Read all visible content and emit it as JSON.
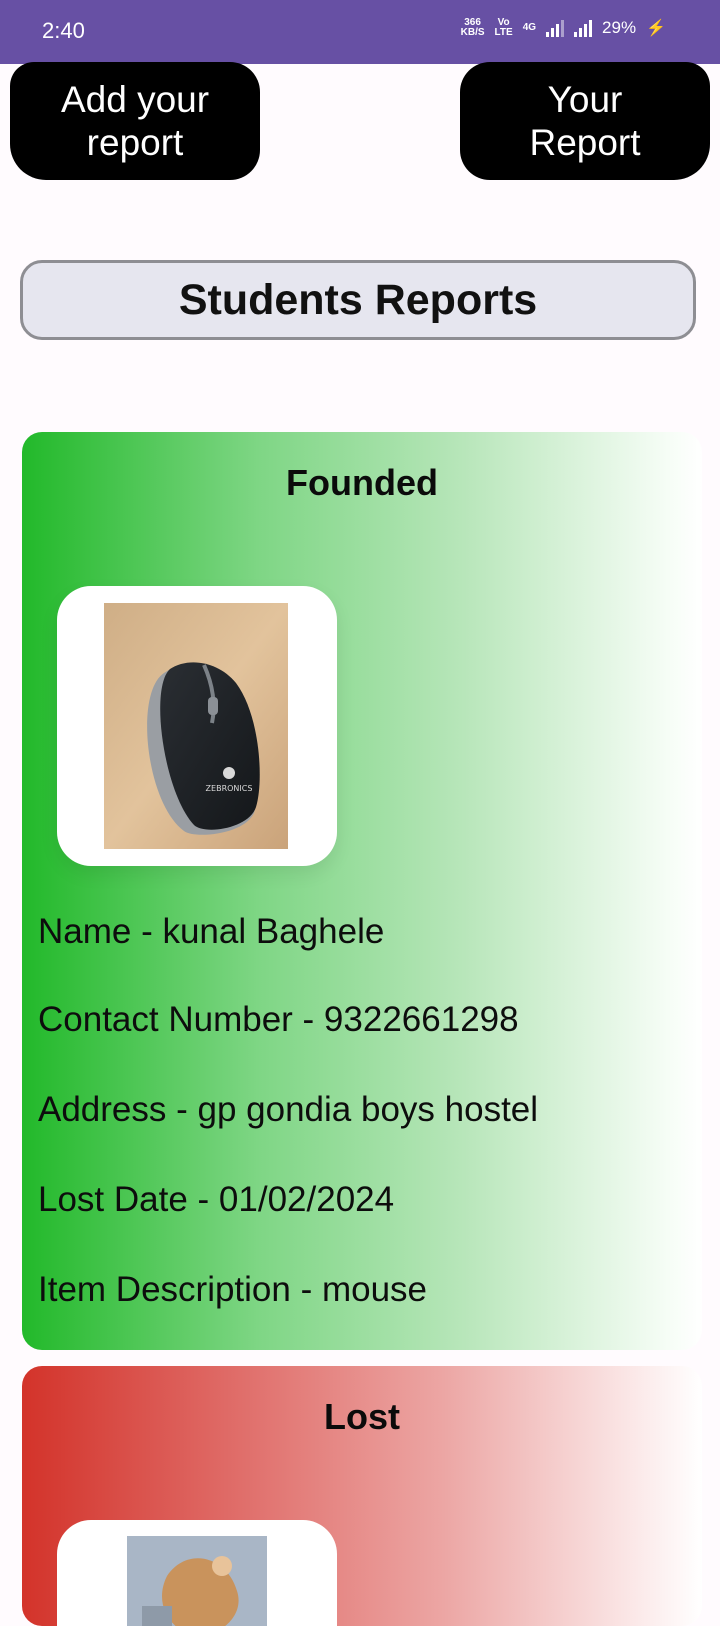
{
  "status_bar": {
    "time": "2:40",
    "net_speed_top": "366",
    "net_speed_bottom": "KB/S",
    "volte_top": "Vo",
    "volte_bottom": "LTE",
    "network_type": "4G",
    "battery": "29%"
  },
  "actions": {
    "add_report_label": "Add your\nreport",
    "your_report_label": "Your\nReport"
  },
  "section": {
    "title": "Students Reports"
  },
  "reports": [
    {
      "status": "Founded",
      "name": "Name - kunal Baghele",
      "contact": "Contact Number - 9322661298",
      "address": "Address - gp gondia boys hostel",
      "date": "Lost Date - 01/02/2024",
      "description": "Item Description - mouse",
      "image_brand_text": "ZEBRONICS"
    },
    {
      "status": "Lost"
    }
  ],
  "colors": {
    "status_bar": "#6750a4",
    "found_card": "#22b92a",
    "lost_card": "#d3332a",
    "button": "#000000"
  }
}
